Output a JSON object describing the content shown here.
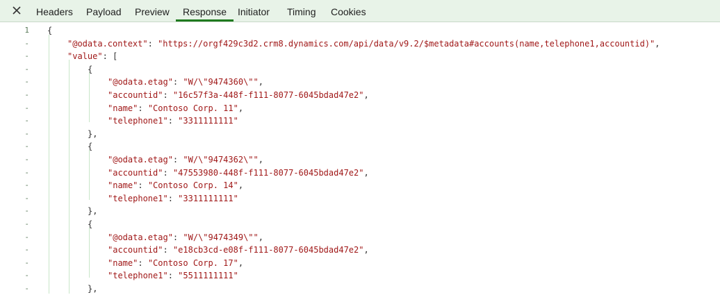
{
  "tabs": [
    {
      "label": "Headers",
      "active": false
    },
    {
      "label": "Payload",
      "active": false
    },
    {
      "label": "Preview",
      "active": false
    },
    {
      "label": "Response",
      "active": true
    },
    {
      "label": "Initiator",
      "active": false
    },
    {
      "label": "Timing",
      "active": false
    },
    {
      "label": "Cookies",
      "active": false
    }
  ],
  "close_icon": "close-icon",
  "colors": {
    "tabbar_bg": "#e8f3e8",
    "active_tab_underline": "#1f7a1f",
    "string": "#a01818",
    "line_number": "#5a7a5a",
    "indent_guide": "#c8e6c8"
  },
  "code": {
    "lines": [
      {
        "num": "1",
        "indent": 0,
        "parts": [
          [
            "p",
            "{"
          ]
        ]
      },
      {
        "num": "-",
        "indent": 1,
        "parts": [
          [
            "k",
            "\"@odata.context\""
          ],
          [
            "p",
            ": "
          ],
          [
            "s",
            "\"https://orgf429c3d2.crm8.dynamics.com/api/data/v9.2/$metadata#accounts(name,telephone1,accountid)\""
          ],
          [
            "p",
            ","
          ]
        ]
      },
      {
        "num": "-",
        "indent": 1,
        "parts": [
          [
            "k",
            "\"value\""
          ],
          [
            "p",
            ": ["
          ]
        ]
      },
      {
        "num": "-",
        "indent": 2,
        "parts": [
          [
            "p",
            "{"
          ]
        ]
      },
      {
        "num": "-",
        "indent": 3,
        "parts": [
          [
            "k",
            "\"@odata.etag\""
          ],
          [
            "p",
            ": "
          ],
          [
            "s",
            "\"W/\\\"9474360\\\"\""
          ],
          [
            "p",
            ","
          ]
        ]
      },
      {
        "num": "-",
        "indent": 3,
        "parts": [
          [
            "k",
            "\"accountid\""
          ],
          [
            "p",
            ": "
          ],
          [
            "s",
            "\"16c57f3a-448f-f111-8077-6045bdad47e2\""
          ],
          [
            "p",
            ","
          ]
        ]
      },
      {
        "num": "-",
        "indent": 3,
        "parts": [
          [
            "k",
            "\"name\""
          ],
          [
            "p",
            ": "
          ],
          [
            "s",
            "\"Contoso Corp. 11\""
          ],
          [
            "p",
            ","
          ]
        ]
      },
      {
        "num": "-",
        "indent": 3,
        "parts": [
          [
            "k",
            "\"telephone1\""
          ],
          [
            "p",
            ": "
          ],
          [
            "s",
            "\"3311111111\""
          ]
        ]
      },
      {
        "num": "-",
        "indent": 2,
        "parts": [
          [
            "p",
            "},"
          ]
        ]
      },
      {
        "num": "-",
        "indent": 2,
        "parts": [
          [
            "p",
            "{"
          ]
        ]
      },
      {
        "num": "-",
        "indent": 3,
        "parts": [
          [
            "k",
            "\"@odata.etag\""
          ],
          [
            "p",
            ": "
          ],
          [
            "s",
            "\"W/\\\"9474362\\\"\""
          ],
          [
            "p",
            ","
          ]
        ]
      },
      {
        "num": "-",
        "indent": 3,
        "parts": [
          [
            "k",
            "\"accountid\""
          ],
          [
            "p",
            ": "
          ],
          [
            "s",
            "\"47553980-448f-f111-8077-6045bdad47e2\""
          ],
          [
            "p",
            ","
          ]
        ]
      },
      {
        "num": "-",
        "indent": 3,
        "parts": [
          [
            "k",
            "\"name\""
          ],
          [
            "p",
            ": "
          ],
          [
            "s",
            "\"Contoso Corp. 14\""
          ],
          [
            "p",
            ","
          ]
        ]
      },
      {
        "num": "-",
        "indent": 3,
        "parts": [
          [
            "k",
            "\"telephone1\""
          ],
          [
            "p",
            ": "
          ],
          [
            "s",
            "\"3311111111\""
          ]
        ]
      },
      {
        "num": "-",
        "indent": 2,
        "parts": [
          [
            "p",
            "},"
          ]
        ]
      },
      {
        "num": "-",
        "indent": 2,
        "parts": [
          [
            "p",
            "{"
          ]
        ]
      },
      {
        "num": "-",
        "indent": 3,
        "parts": [
          [
            "k",
            "\"@odata.etag\""
          ],
          [
            "p",
            ": "
          ],
          [
            "s",
            "\"W/\\\"9474349\\\"\""
          ],
          [
            "p",
            ","
          ]
        ]
      },
      {
        "num": "-",
        "indent": 3,
        "parts": [
          [
            "k",
            "\"accountid\""
          ],
          [
            "p",
            ": "
          ],
          [
            "s",
            "\"e18cb3cd-e08f-f111-8077-6045bdad47e2\""
          ],
          [
            "p",
            ","
          ]
        ]
      },
      {
        "num": "-",
        "indent": 3,
        "parts": [
          [
            "k",
            "\"name\""
          ],
          [
            "p",
            ": "
          ],
          [
            "s",
            "\"Contoso Corp. 17\""
          ],
          [
            "p",
            ","
          ]
        ]
      },
      {
        "num": "-",
        "indent": 3,
        "parts": [
          [
            "k",
            "\"telephone1\""
          ],
          [
            "p",
            ": "
          ],
          [
            "s",
            "\"5511111111\""
          ]
        ]
      },
      {
        "num": "-",
        "indent": 2,
        "parts": [
          [
            "p",
            "},"
          ]
        ]
      }
    ]
  }
}
